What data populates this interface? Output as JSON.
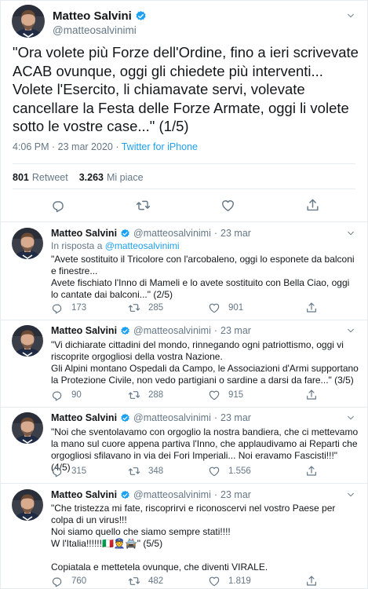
{
  "colors": {
    "accent": "#1da1f2",
    "muted": "#657786",
    "text": "#14171a",
    "border": "#e6ecf0"
  },
  "main": {
    "name": "Matteo Salvini",
    "handle": "@matteosalvinimi",
    "text": "\"Ora volete più Forze dell'Ordine, fino a ieri scrivevate ACAB ovunque, oggi gli chiedete più interventi... Volete l'Esercito, li chiamavate servi, volevate cancellare la Festa delle Forze Armate, oggi li volete sotto le vostre case...\" (1/5)",
    "time": "4:06 PM · 23 mar 2020 · ",
    "source": "Twitter for iPhone",
    "retweets_count": "801",
    "retweets_label": "Retweet",
    "likes_count": "3.263",
    "likes_label": "Mi piace"
  },
  "replies": [
    {
      "name": "Matteo Salvini",
      "handle": "@matteosalvinimi",
      "dot": "·",
      "date": "23 mar",
      "in_reply_prefix": "In risposta a ",
      "in_reply_handle": "@matteosalvinimi",
      "text": "\"Avete sostituito il Tricolore con l'arcobaleno, oggi lo esponete da balconi e finestre...\nAvete fischiato l'Inno di Mameli e lo avete sostituito con Bella Ciao, oggi lo cantate dai balconi...\" (2/5)",
      "replies": "173",
      "retweets": "285",
      "likes": "901"
    },
    {
      "name": "Matteo Salvini",
      "handle": "@matteosalvinimi",
      "dot": "·",
      "date": "23 mar",
      "text": "\"Vi dichiarate cittadini del mondo, rinnegando ogni patriottismo, oggi vi riscoprite orgogliosi della vostra Nazione.\nGli Alpini montano Ospedali da Campo, le Associazioni d'Armi supportano la Protezione Civile, non vedo partigiani o sardine a darsi da fare...\" (3/5)",
      "replies": "90",
      "retweets": "288",
      "likes": "915"
    },
    {
      "name": "Matteo Salvini",
      "handle": "@matteosalvinimi",
      "dot": "·",
      "date": "23 mar",
      "text": "\"Noi che sventolavamo con orgoglio la nostra bandiera, che ci mettevamo la mano sul cuore appena partiva l'Inno, che applaudivamo ai Reparti che orgogliosi sfilavano in via dei Fori Imperiali... Noi eravamo Fascisti!!!\" (4/5)",
      "replies": "315",
      "retweets": "348",
      "likes": "1.556"
    },
    {
      "name": "Matteo Salvini",
      "handle": "@matteosalvinimi",
      "dot": "·",
      "date": "23 mar",
      "text": "\"Che tristezza mi fate, riscoprirvi e riconoscervi nel vostro Paese per colpa di un virus!!!\nNoi siamo quello che siamo sempre stati!!!!\nW l'Italia!!!!!!🇮🇹👮🚔\" (5/5)\n\nCopiatala e mettetela ovunque, che diventi VIRALE.",
      "replies": "760",
      "retweets": "482",
      "likes": "1.819"
    }
  ],
  "icons": [
    "reply-icon",
    "retweet-icon",
    "like-icon",
    "share-icon",
    "verified-badge-icon",
    "chevron-down-icon"
  ]
}
